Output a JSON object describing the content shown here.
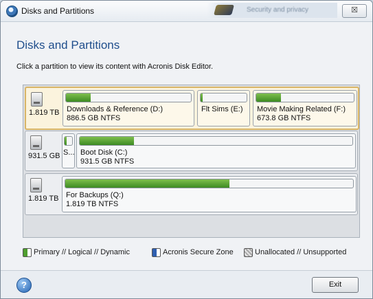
{
  "window": {
    "title": "Disks and Partitions",
    "close_label": "☒",
    "background_hint": "Security and privacy"
  },
  "header": {
    "heading": "Disks and Partitions",
    "instruction": "Click a partition to view its content with Acronis Disk Editor."
  },
  "disks": [
    {
      "size": "1.819 TB",
      "selected": true,
      "partitions": [
        {
          "name": "Downloads & Reference (D:)",
          "size": "886.5 GB  NTFS",
          "used": 0.2
        },
        {
          "name": "Flt Sims (E:)",
          "size": "",
          "used": 0.05
        },
        {
          "name": "Movie Making Related (F:)",
          "size": "673.8 GB  NTFS",
          "used": 0.25
        }
      ]
    },
    {
      "size": "931.5 GB",
      "selected": false,
      "partitions": [
        {
          "name": "S...",
          "size": "",
          "used": 0.3
        },
        {
          "name": "Boot Disk (C:)",
          "size": "931.5 GB  NTFS",
          "used": 0.2
        }
      ]
    },
    {
      "size": "1.819 TB",
      "selected": false,
      "partitions": [
        {
          "name": "For Backups (Q:)",
          "size": "1.819 TB  NTFS",
          "used": 0.57
        }
      ]
    }
  ],
  "legend": [
    {
      "label": "Primary // Logical // Dynamic",
      "color": "#4f9e2f",
      "icon": "primary-partition-swatch"
    },
    {
      "label": "Acronis Secure Zone",
      "color": "#2f5fb0",
      "icon": "secure-zone-swatch"
    },
    {
      "label": "Unallocated // Unsupported",
      "color": "#a8a8a8",
      "icon": "unallocated-swatch"
    }
  ],
  "footer": {
    "help_label": "?",
    "exit_label": "Exit"
  }
}
